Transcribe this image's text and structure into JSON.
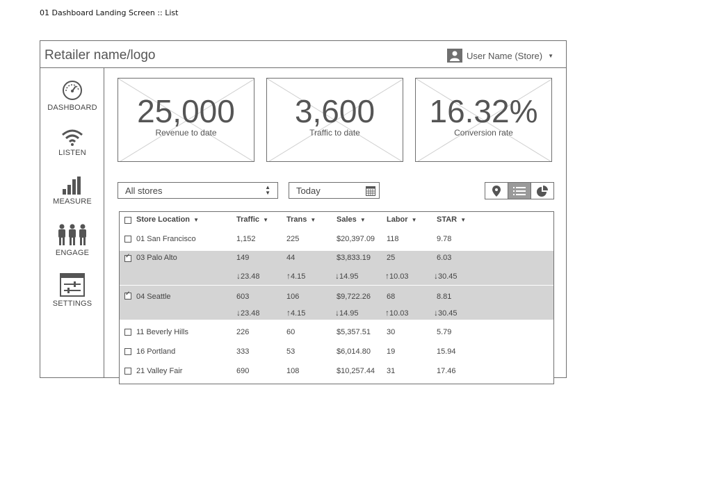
{
  "caption": "01 Dashboard Landing Screen :: List",
  "header": {
    "brand": "Retailer name/logo",
    "user": "User Name (Store)"
  },
  "sidebar": [
    {
      "label": "DASHBOARD",
      "icon": "gauge-icon"
    },
    {
      "label": "LISTEN",
      "icon": "wifi-icon"
    },
    {
      "label": "MEASURE",
      "icon": "bar-chart-icon"
    },
    {
      "label": "ENGAGE",
      "icon": "people-icon"
    },
    {
      "label": "SETTINGS",
      "icon": "settings-panel-icon"
    }
  ],
  "kpis": [
    {
      "value": "25,000",
      "label": "Revenue to date"
    },
    {
      "value": "3,600",
      "label": "Traffic to date"
    },
    {
      "value": "16.32%",
      "label": "Conversion rate"
    }
  ],
  "filters": {
    "store": "All stores",
    "date": "Today"
  },
  "table": {
    "headers": [
      "Store Location",
      "Traffic",
      "Trans",
      "Sales",
      "Labor",
      "STAR"
    ],
    "rows": [
      {
        "loc": "01 San Francisco",
        "traffic": "1,152",
        "trans": "225",
        "sales": "$20,397.09",
        "labor": "118",
        "star": "9.78",
        "checked": false
      },
      {
        "loc": "03  Palo Alto",
        "traffic": "149",
        "trans": "44",
        "sales": "$3,833.19",
        "labor": "25",
        "star": "6.03",
        "checked": true,
        "delta": {
          "traffic": "23.48",
          "trans": "4.15",
          "sales": "14.95",
          "labor": "10.03",
          "star": "30.45"
        }
      },
      {
        "loc": "04  Seattle",
        "traffic": "603",
        "trans": "106",
        "sales": "$9,722.26",
        "labor": "68",
        "star": "8.81",
        "checked": true,
        "delta": {
          "traffic": "23.48",
          "trans": "4.15",
          "sales": "14.95",
          "labor": "10.03",
          "star": "30.45"
        }
      },
      {
        "loc": "11 Beverly Hills",
        "traffic": "226",
        "trans": "60",
        "sales": "$5,357.51",
        "labor": "30",
        "star": "5.79",
        "checked": false
      },
      {
        "loc": "16 Portland",
        "traffic": "333",
        "trans": "53",
        "sales": "$6,014.80",
        "labor": "19",
        "star": "15.94",
        "checked": false
      },
      {
        "loc": "21 Valley Fair",
        "traffic": "690",
        "trans": "108",
        "sales": "$10,257.44",
        "labor": "31",
        "star": "17.46",
        "checked": false
      }
    ]
  },
  "arrows": {
    "down": "↓",
    "up": "↑"
  },
  "colors": {
    "border": "#6f6f6f",
    "selected_row": "#d4d4d4",
    "active_toggle": "#9a9a9a"
  }
}
